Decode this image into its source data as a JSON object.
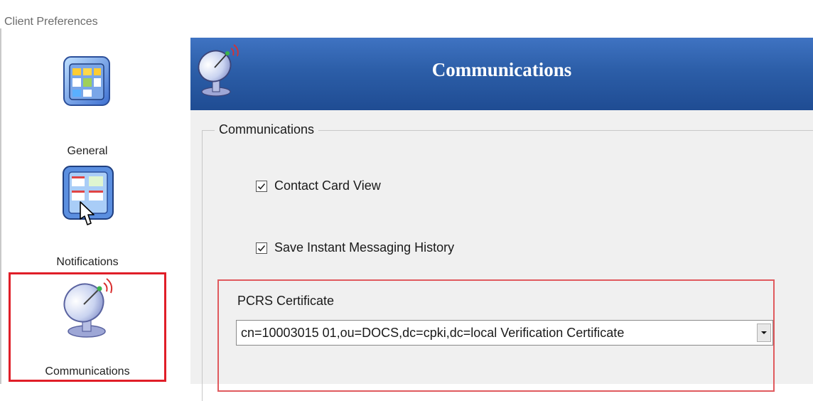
{
  "window": {
    "title": "Client Preferences"
  },
  "sidebar": {
    "items": [
      {
        "label": "General",
        "icon": "general-icon",
        "selected": false
      },
      {
        "label": "Notifications",
        "icon": "notifications-icon",
        "selected": false
      },
      {
        "label": "Communications",
        "icon": "satellite-dish-icon",
        "selected": true
      }
    ]
  },
  "header": {
    "title": "Communications",
    "icon": "satellite-dish-icon"
  },
  "group": {
    "title": "Communications",
    "options": [
      {
        "label": "Contact Card View",
        "checked": true
      },
      {
        "label": "Save Instant Messaging History",
        "checked": true
      }
    ]
  },
  "certificate": {
    "label": "PCRS Certificate",
    "selected_value": "cn=10003015 01,ou=DOCS,dc=cpki,dc=local Verification Certificate"
  },
  "colors": {
    "header_blue": "#2c5ea8",
    "selection_red": "#e01e28",
    "panel_gray": "#f0f0f0"
  }
}
